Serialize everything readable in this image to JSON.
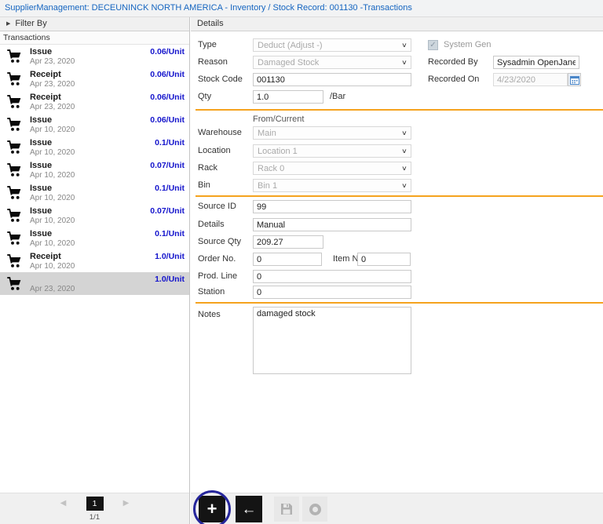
{
  "breadcrumb": "SupplierManagement: DECEUNINCK NORTH AMERICA - Inventory / Stock Record: 001130 -Transactions",
  "icons": {
    "expand": "▶",
    "prev": "◀",
    "next": "▶",
    "chevron": "∨",
    "check": "✓"
  },
  "colors": {
    "accent_orange": "#f5a31e",
    "value_blue": "#1414cc",
    "breadcrumb_blue": "#1565c0",
    "annotation_blue": "#26269c"
  },
  "left_panel": {
    "filter_by_label": "Filter By",
    "transactions_label": "Transactions",
    "transactions": [
      {
        "type": "Issue",
        "date": "Apr 23, 2020",
        "value": "0.06/Unit",
        "selected": false
      },
      {
        "type": "Receipt",
        "date": "Apr 23, 2020",
        "value": "0.06/Unit",
        "selected": false
      },
      {
        "type": "Receipt",
        "date": "Apr 23, 2020",
        "value": "0.06/Unit",
        "selected": false
      },
      {
        "type": "Issue",
        "date": "Apr 10, 2020",
        "value": "0.06/Unit",
        "selected": false
      },
      {
        "type": "Issue",
        "date": "Apr 10, 2020",
        "value": "0.1/Unit",
        "selected": false
      },
      {
        "type": "Issue",
        "date": "Apr 10, 2020",
        "value": "0.07/Unit",
        "selected": false
      },
      {
        "type": "Issue",
        "date": "Apr 10, 2020",
        "value": "0.1/Unit",
        "selected": false
      },
      {
        "type": "Issue",
        "date": "Apr 10, 2020",
        "value": "0.07/Unit",
        "selected": false
      },
      {
        "type": "Issue",
        "date": "Apr 10, 2020",
        "value": "0.1/Unit",
        "selected": false
      },
      {
        "type": "Receipt",
        "date": "Apr 10, 2020",
        "value": "1.0/Unit",
        "selected": false
      },
      {
        "type": "",
        "date": "Apr 23, 2020",
        "value": "1.0/Unit",
        "selected": true
      }
    ],
    "pagination": {
      "current_page": "1",
      "page_info": "1/1"
    }
  },
  "details": {
    "title": "Details",
    "type_label": "Type",
    "type_value": "Deduct (Adjust -)",
    "system_gen_label": "System Gen",
    "reason_label": "Reason",
    "reason_value": "Damaged Stock",
    "recorded_by_label": "Recorded By",
    "recorded_by_value": "Sysadmin OpenJanela",
    "stock_code_label": "Stock Code",
    "stock_code_value": "001130",
    "recorded_on_label": "Recorded On",
    "recorded_on_value": "4/23/2020",
    "qty_label": "Qty",
    "qty_value": "1.0",
    "qty_unit": "/Bar",
    "from_current_label": "From/Current",
    "warehouse_label": "Warehouse",
    "warehouse_value": "Main",
    "location_label": "Location",
    "location_value": "Location 1",
    "rack_label": "Rack",
    "rack_value": "Rack 0",
    "bin_label": "Bin",
    "bin_value": "Bin 1",
    "source_id_label": "Source ID",
    "source_id_value": "99",
    "details_label": "Details",
    "details_value": "Manual",
    "source_qty_label": "Source Qty",
    "source_qty_value": "209.27",
    "order_no_label": "Order No.",
    "order_no_value": "0",
    "item_no_label": "Item No.",
    "item_no_value": "0",
    "prod_line_label": "Prod. Line",
    "prod_line_value": "0",
    "station_label": "Station",
    "station_value": "0",
    "notes_label": "Notes",
    "notes_value": "damaged stock"
  },
  "toolbar": {
    "add_label": "+",
    "back_label": "←"
  }
}
